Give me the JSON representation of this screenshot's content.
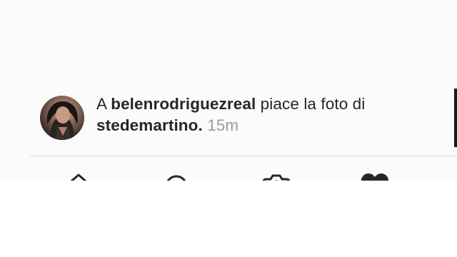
{
  "notification": {
    "prefix": "A ",
    "actor": "belenrodriguezreal",
    "action": " piace la foto di ",
    "target": "stedemartino.",
    "time": " 15m"
  },
  "icons": {
    "avatar": "profile-photo",
    "tabs": [
      "home-icon",
      "search-icon",
      "camera-icon",
      "heart-icon"
    ]
  },
  "colors": {
    "text": "#262626",
    "timestamp": "#9a9a9a",
    "divider": "#dcdcdc"
  }
}
